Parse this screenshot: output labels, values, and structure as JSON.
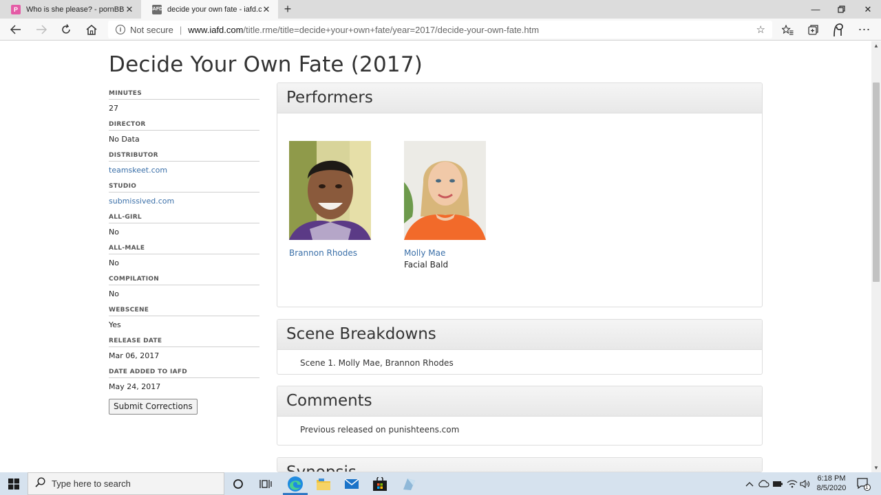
{
  "browser": {
    "tabs": [
      {
        "favicon": "P",
        "title": "Who is she please? - pornBB",
        "active": false
      },
      {
        "favicon": "IAFD",
        "title": "decide your own fate - iafd.com",
        "active": true
      }
    ],
    "address": {
      "security_text": "Not secure",
      "domain": "www.iafd.com",
      "path": "/title.rme/title=decide+your+own+fate/year=2017/decide-your-own-fate.htm"
    }
  },
  "page": {
    "title": "Decide Your Own Fate (2017)",
    "fields": [
      {
        "label": "MINUTES",
        "value": "27",
        "link": false
      },
      {
        "label": "DIRECTOR",
        "value": "No Data",
        "link": false
      },
      {
        "label": "DISTRIBUTOR",
        "value": "teamskeet.com",
        "link": true
      },
      {
        "label": "STUDIO",
        "value": "submissived.com",
        "link": true
      },
      {
        "label": "ALL-GIRL",
        "value": "No",
        "link": false
      },
      {
        "label": "ALL-MALE",
        "value": "No",
        "link": false
      },
      {
        "label": "COMPILATION",
        "value": "No",
        "link": false
      },
      {
        "label": "WEBSCENE",
        "value": "Yes",
        "link": false
      },
      {
        "label": "RELEASE DATE",
        "value": "Mar 06, 2017",
        "link": false
      },
      {
        "label": "DATE ADDED TO IAFD",
        "value": "May 24, 2017",
        "link": false
      }
    ],
    "submit_label": "Submit Corrections",
    "performers_heading": "Performers",
    "performers": [
      {
        "name": "Brannon Rhodes",
        "tags": ""
      },
      {
        "name": "Molly Mae",
        "tags": "Facial Bald"
      }
    ],
    "scenes_heading": "Scene Breakdowns",
    "scene_text": "Scene 1. Molly Mae, Brannon Rhodes",
    "comments_heading": "Comments",
    "comment_text": "Previous released on punishteens.com",
    "synopsis_heading": "Synopsis"
  },
  "taskbar": {
    "search_placeholder": "Type here to search",
    "time": "6:18 PM",
    "date": "8/5/2020",
    "notification_count": "1"
  }
}
